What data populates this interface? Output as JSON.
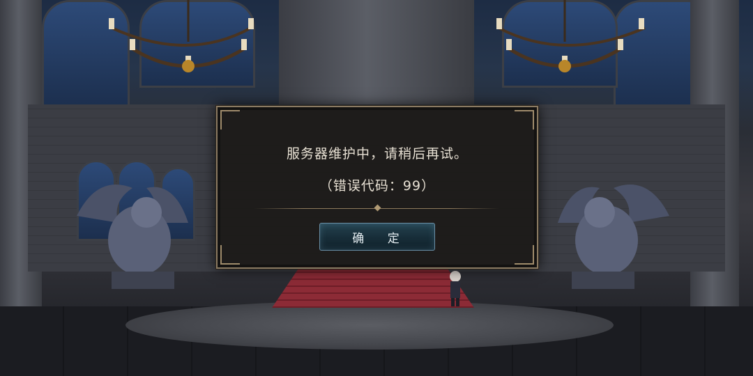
{
  "dialog": {
    "message": "服务器维护中，请稍后再试。",
    "error_code": "（错误代码：99）",
    "confirm_label": "确 定"
  },
  "colors": {
    "dialog_border": "#8a7a62",
    "button_fill": "#172d38",
    "carpet": "#8c2b36"
  }
}
